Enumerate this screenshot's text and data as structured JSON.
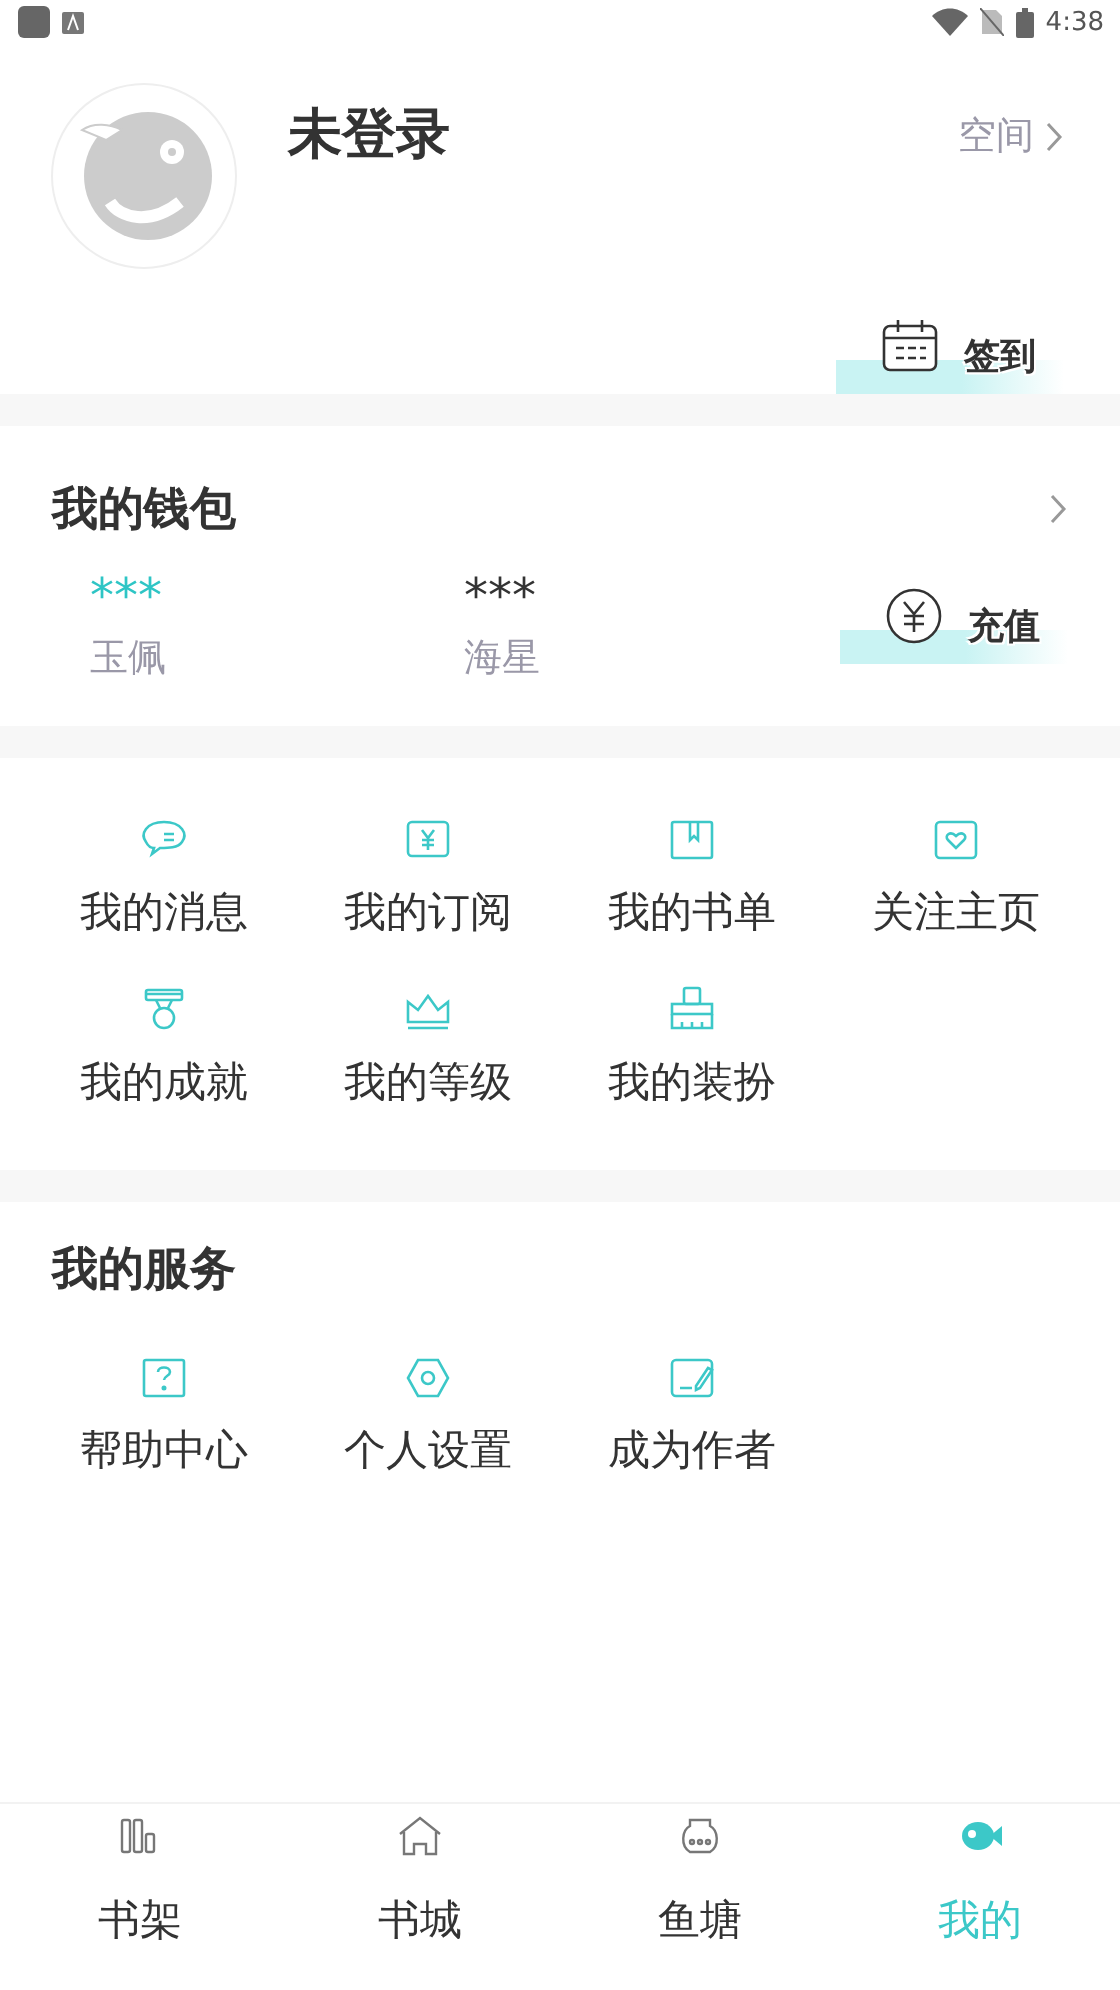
{
  "status_bar": {
    "time": "4:38"
  },
  "profile": {
    "name": "未登录",
    "space_link": "空间",
    "checkin_button": "签到"
  },
  "wallet": {
    "title": "我的钱包",
    "balances": [
      {
        "amount": "***",
        "label": "玉佩",
        "color": "#2ec5c5"
      },
      {
        "amount": "***",
        "label": "海星",
        "color": "#333333"
      }
    ],
    "recharge_button": "充值"
  },
  "features": [
    {
      "label": "我的消息"
    },
    {
      "label": "我的订阅"
    },
    {
      "label": "我的书单"
    },
    {
      "label": "关注主页"
    },
    {
      "label": "我的成就"
    },
    {
      "label": "我的等级"
    },
    {
      "label": "我的装扮"
    }
  ],
  "services": {
    "title": "我的服务",
    "items": [
      {
        "label": "帮助中心"
      },
      {
        "label": "个人设置"
      },
      {
        "label": "成为作者"
      }
    ]
  },
  "tab_bar": [
    {
      "label": "书架",
      "selected": false
    },
    {
      "label": "书城",
      "selected": false
    },
    {
      "label": "鱼塘",
      "selected": false
    },
    {
      "label": "我的",
      "selected": true
    }
  ]
}
